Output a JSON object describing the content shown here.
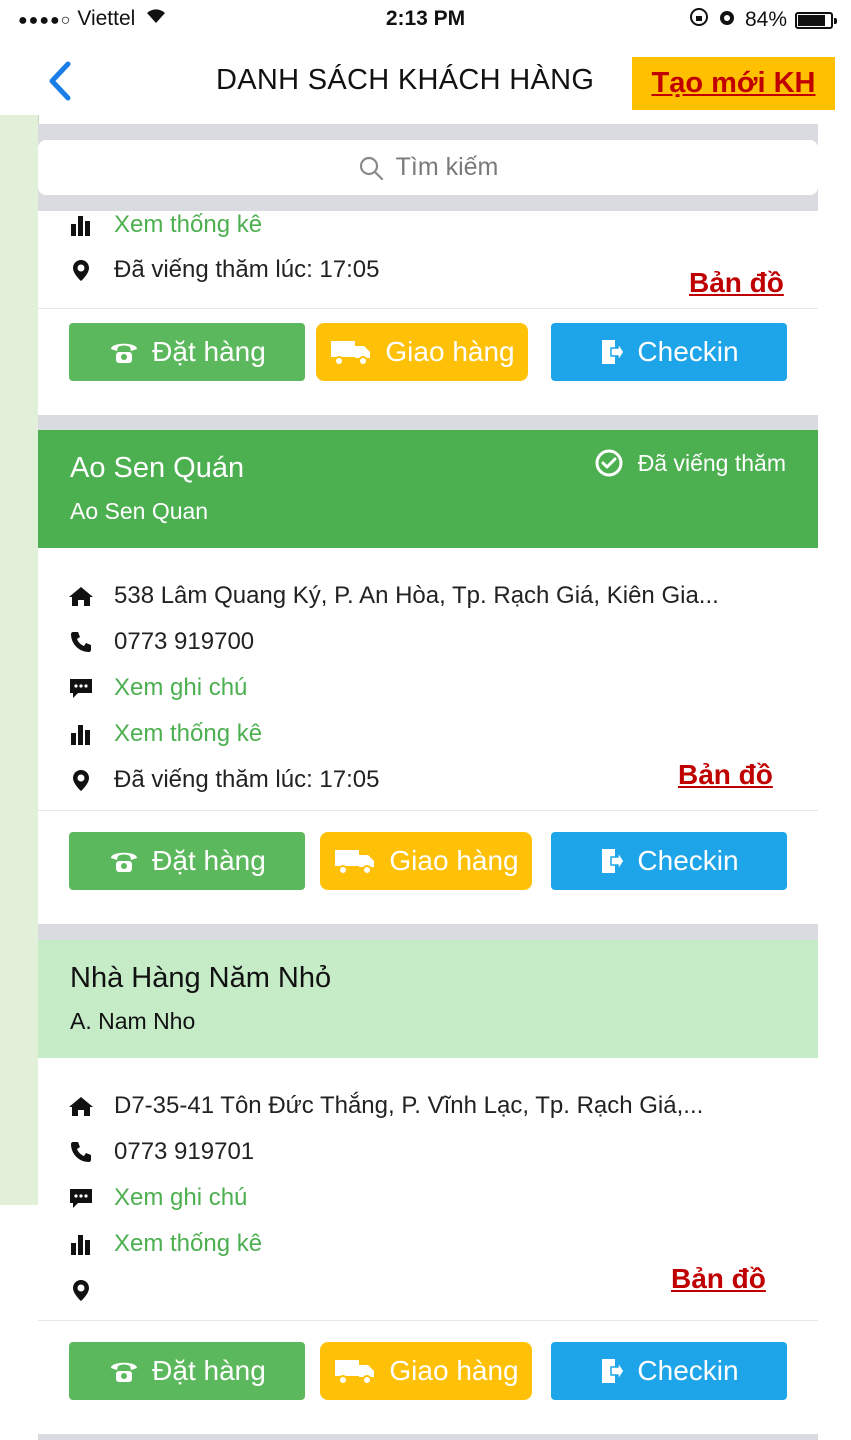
{
  "status_bar": {
    "carrier": "Viettel",
    "time": "2:13 PM",
    "battery": "84%",
    "battery_level": 0.84
  },
  "nav": {
    "title": "DANH SÁCH KHÁCH HÀNG",
    "new_customer": "Tạo mới KH"
  },
  "search": {
    "placeholder": "Tìm kiếm"
  },
  "colors": {
    "green": "#4caf50",
    "light_green": "#c5ebc7",
    "yellow": "#ffc107",
    "blue": "#1ea5e9",
    "red": "#c00000",
    "highlight": "#ffc000"
  },
  "cards": [
    {
      "stats": "Xem thống kê",
      "visited_at": "Đã viếng thăm lúc: 17:05",
      "map": "Bản đồ",
      "buttons": {
        "order": "Đặt hàng",
        "ship": "Giao hàng",
        "checkin": "Checkin"
      }
    },
    {
      "name": "Ao Sen Quán",
      "subname": "Ao Sen Quan",
      "status": "Đã viếng thăm",
      "address": "538 Lâm Quang Ký, P. An Hòa,  Tp. Rạch Giá, Kiên Gia...",
      "phone": "0773 919700",
      "notes": "Xem ghi chú",
      "stats": "Xem thống kê",
      "visited_at": "Đã viếng thăm lúc: 17:05",
      "map": "Bản đồ",
      "buttons": {
        "order": "Đặt hàng",
        "ship": "Giao hàng",
        "checkin": "Checkin"
      }
    },
    {
      "name": "Nhà Hàng Năm Nhỏ",
      "subname": "A. Nam Nho",
      "address": "D7-35-41 Tôn Đức Thắng, P. Vĩnh Lạc,  Tp. Rạch Giá,...",
      "phone": "0773 919701",
      "notes": "Xem ghi chú",
      "stats": "Xem thống kê",
      "visited_at": "",
      "map": "Bản đồ",
      "buttons": {
        "order": "Đặt hàng",
        "ship": "Giao hàng",
        "checkin": "Checkin"
      }
    }
  ]
}
